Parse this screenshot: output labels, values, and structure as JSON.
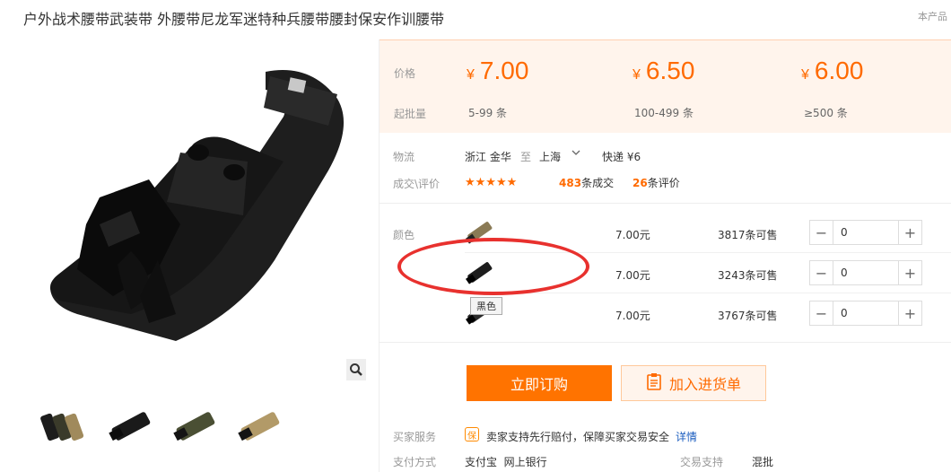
{
  "product": {
    "title": "户外战术腰带武装带 外腰带尼龙军迷特种兵腰带腰封保安作训腰带",
    "corner_tag": "本产品"
  },
  "gallery": {
    "zoom_icon": "magnifier-icon",
    "thumbnails": [
      {
        "name": "thumb-mixed-belts"
      },
      {
        "name": "thumb-black-belt"
      },
      {
        "name": "thumb-green-belt"
      },
      {
        "name": "thumb-tan-belt"
      }
    ]
  },
  "pricing": {
    "price_label": "价格",
    "moq_label": "起批量",
    "currency": "¥",
    "tiers": [
      {
        "price": "7.00",
        "range": "5-99 条"
      },
      {
        "price": "6.50",
        "range": "100-499 条"
      },
      {
        "price": "6.00",
        "range": "≥500 条"
      }
    ]
  },
  "logistics": {
    "label": "物流",
    "from": "浙江 金华",
    "to_word": "至",
    "to": "上海",
    "shipping": "快递 ¥6"
  },
  "reviews": {
    "label": "成交\\评价",
    "stars": "★★★★★",
    "rating": 4.5,
    "deals_count": "483",
    "deals_suffix": "条成交",
    "review_count": "26",
    "review_suffix": "条评价"
  },
  "sku": {
    "label": "颜色",
    "rows": [
      {
        "price": "7.00元",
        "stock": "3817条可售",
        "qty": "0",
        "color": "#8a7a55"
      },
      {
        "price": "7.00元",
        "stock": "3243条可售",
        "qty": "0",
        "color": "#1d1d1d"
      },
      {
        "price": "7.00元",
        "stock": "3767条可售",
        "qty": "0",
        "color": "#2b2b2b"
      }
    ],
    "tooltip": "黑色"
  },
  "actions": {
    "order_label": "立即订购",
    "cart_label": "加入进货单"
  },
  "service": {
    "label": "买家服务",
    "badge": "保",
    "text": "卖家支持先行赔付，保障买家交易安全",
    "detail_link": "详情"
  },
  "payment": {
    "label": "支付方式",
    "methods": "支付宝  网上银行",
    "trade_label": "交易支持",
    "trade_value": "混批"
  },
  "colors": {
    "accent": "#ff6a00",
    "order_button": "#ff7300",
    "annotation_circle": "#e8312e"
  }
}
